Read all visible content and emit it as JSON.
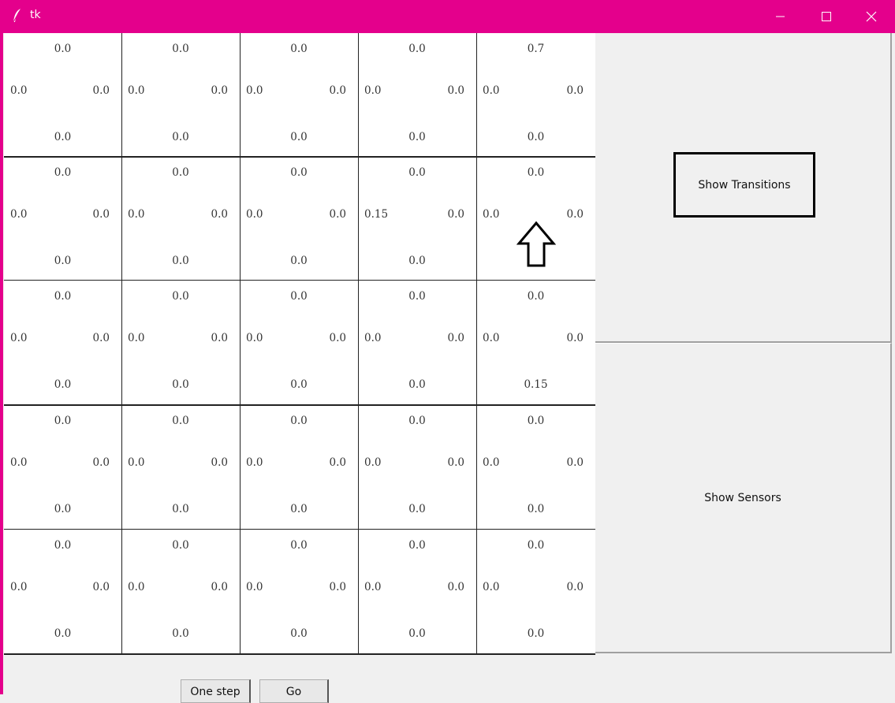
{
  "window": {
    "title": "tk",
    "accent_color": "#e4008c",
    "icons": {
      "app": "feather-icon",
      "minimize": "minimize-icon",
      "maximize": "maximize-icon",
      "close": "close-icon"
    }
  },
  "grid": {
    "rows": 5,
    "cols": 5,
    "cells": [
      [
        {
          "top": "0.0",
          "left": "0.0",
          "right": "0.0",
          "bottom": "0.0"
        },
        {
          "top": "0.0",
          "left": "0.0",
          "right": "0.0",
          "bottom": "0.0"
        },
        {
          "top": "0.0",
          "left": "0.0",
          "right": "0.0",
          "bottom": "0.0"
        },
        {
          "top": "0.0",
          "left": "0.0",
          "right": "0.0",
          "bottom": "0.0"
        },
        {
          "top": "0.7",
          "left": "0.0",
          "right": "0.0",
          "bottom": "0.0"
        }
      ],
      [
        {
          "top": "0.0",
          "left": "0.0",
          "right": "0.0",
          "bottom": "0.0"
        },
        {
          "top": "0.0",
          "left": "0.0",
          "right": "0.0",
          "bottom": "0.0"
        },
        {
          "top": "0.0",
          "left": "0.0",
          "right": "0.0",
          "bottom": "0.0"
        },
        {
          "top": "0.0",
          "left": "0.15",
          "right": "0.0",
          "bottom": "0.0"
        },
        {
          "top": "0.0",
          "left": "0.0",
          "right": "0.0",
          "bottom": "0.0"
        }
      ],
      [
        {
          "top": "0.0",
          "left": "0.0",
          "right": "0.0",
          "bottom": "0.0"
        },
        {
          "top": "0.0",
          "left": "0.0",
          "right": "0.0",
          "bottom": "0.0"
        },
        {
          "top": "0.0",
          "left": "0.0",
          "right": "0.0",
          "bottom": "0.0"
        },
        {
          "top": "0.0",
          "left": "0.0",
          "right": "0.0",
          "bottom": "0.0"
        },
        {
          "top": "0.0",
          "left": "0.0",
          "right": "0.0",
          "bottom": "0.15"
        }
      ],
      [
        {
          "top": "0.0",
          "left": "0.0",
          "right": "0.0",
          "bottom": "0.0"
        },
        {
          "top": "0.0",
          "left": "0.0",
          "right": "0.0",
          "bottom": "0.0"
        },
        {
          "top": "0.0",
          "left": "0.0",
          "right": "0.0",
          "bottom": "0.0"
        },
        {
          "top": "0.0",
          "left": "0.0",
          "right": "0.0",
          "bottom": "0.0"
        },
        {
          "top": "0.0",
          "left": "0.0",
          "right": "0.0",
          "bottom": "0.0"
        }
      ],
      [
        {
          "top": "0.0",
          "left": "0.0",
          "right": "0.0",
          "bottom": "0.0"
        },
        {
          "top": "0.0",
          "left": "0.0",
          "right": "0.0",
          "bottom": "0.0"
        },
        {
          "top": "0.0",
          "left": "0.0",
          "right": "0.0",
          "bottom": "0.0"
        },
        {
          "top": "0.0",
          "left": "0.0",
          "right": "0.0",
          "bottom": "0.0"
        },
        {
          "top": "0.0",
          "left": "0.0",
          "right": "0.0",
          "bottom": "0.0"
        }
      ]
    ],
    "robot": {
      "row": 1,
      "col": 4,
      "heading": "up",
      "icon": "up-arrow-icon"
    }
  },
  "buttons": {
    "show_transitions": "Show Transitions",
    "show_sensors": "Show Sensors",
    "one_step": "One step",
    "go": "Go"
  }
}
